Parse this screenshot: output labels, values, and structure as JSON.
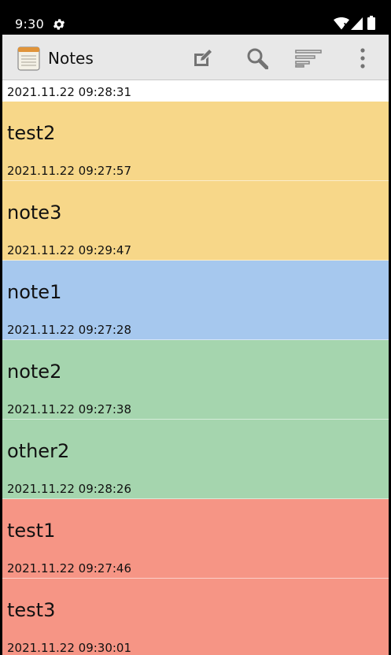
{
  "status_bar": {
    "time": "9:30",
    "icons": [
      "settings-gear-icon",
      "wifi-icon",
      "signal-icon",
      "battery-icon"
    ]
  },
  "toolbar": {
    "title": "Notes",
    "actions": [
      "new-note-icon",
      "search-icon",
      "sort-icon",
      "overflow-menu-icon"
    ]
  },
  "colors": {
    "yellow": "#f7d789",
    "blue": "#a6c8ee",
    "green": "#a5d5ae",
    "red": "#f69585",
    "white": "#ffffff"
  },
  "notes": [
    {
      "title": "",
      "date": "2021.11.22 09:28:31",
      "color": "#ffffff"
    },
    {
      "title": "test2",
      "date": "2021.11.22 09:27:57",
      "color": "#f7d789"
    },
    {
      "title": "note3",
      "date": "2021.11.22 09:29:47",
      "color": "#f7d789"
    },
    {
      "title": "note1",
      "date": "2021.11.22 09:27:28",
      "color": "#a6c8ee"
    },
    {
      "title": "note2",
      "date": "2021.11.22 09:27:38",
      "color": "#a5d5ae"
    },
    {
      "title": "other2",
      "date": "2021.11.22 09:28:26",
      "color": "#a5d5ae"
    },
    {
      "title": "test1",
      "date": "2021.11.22 09:27:46",
      "color": "#f69585"
    },
    {
      "title": "test3",
      "date": "2021.11.22 09:30:01",
      "color": "#f69585"
    }
  ]
}
